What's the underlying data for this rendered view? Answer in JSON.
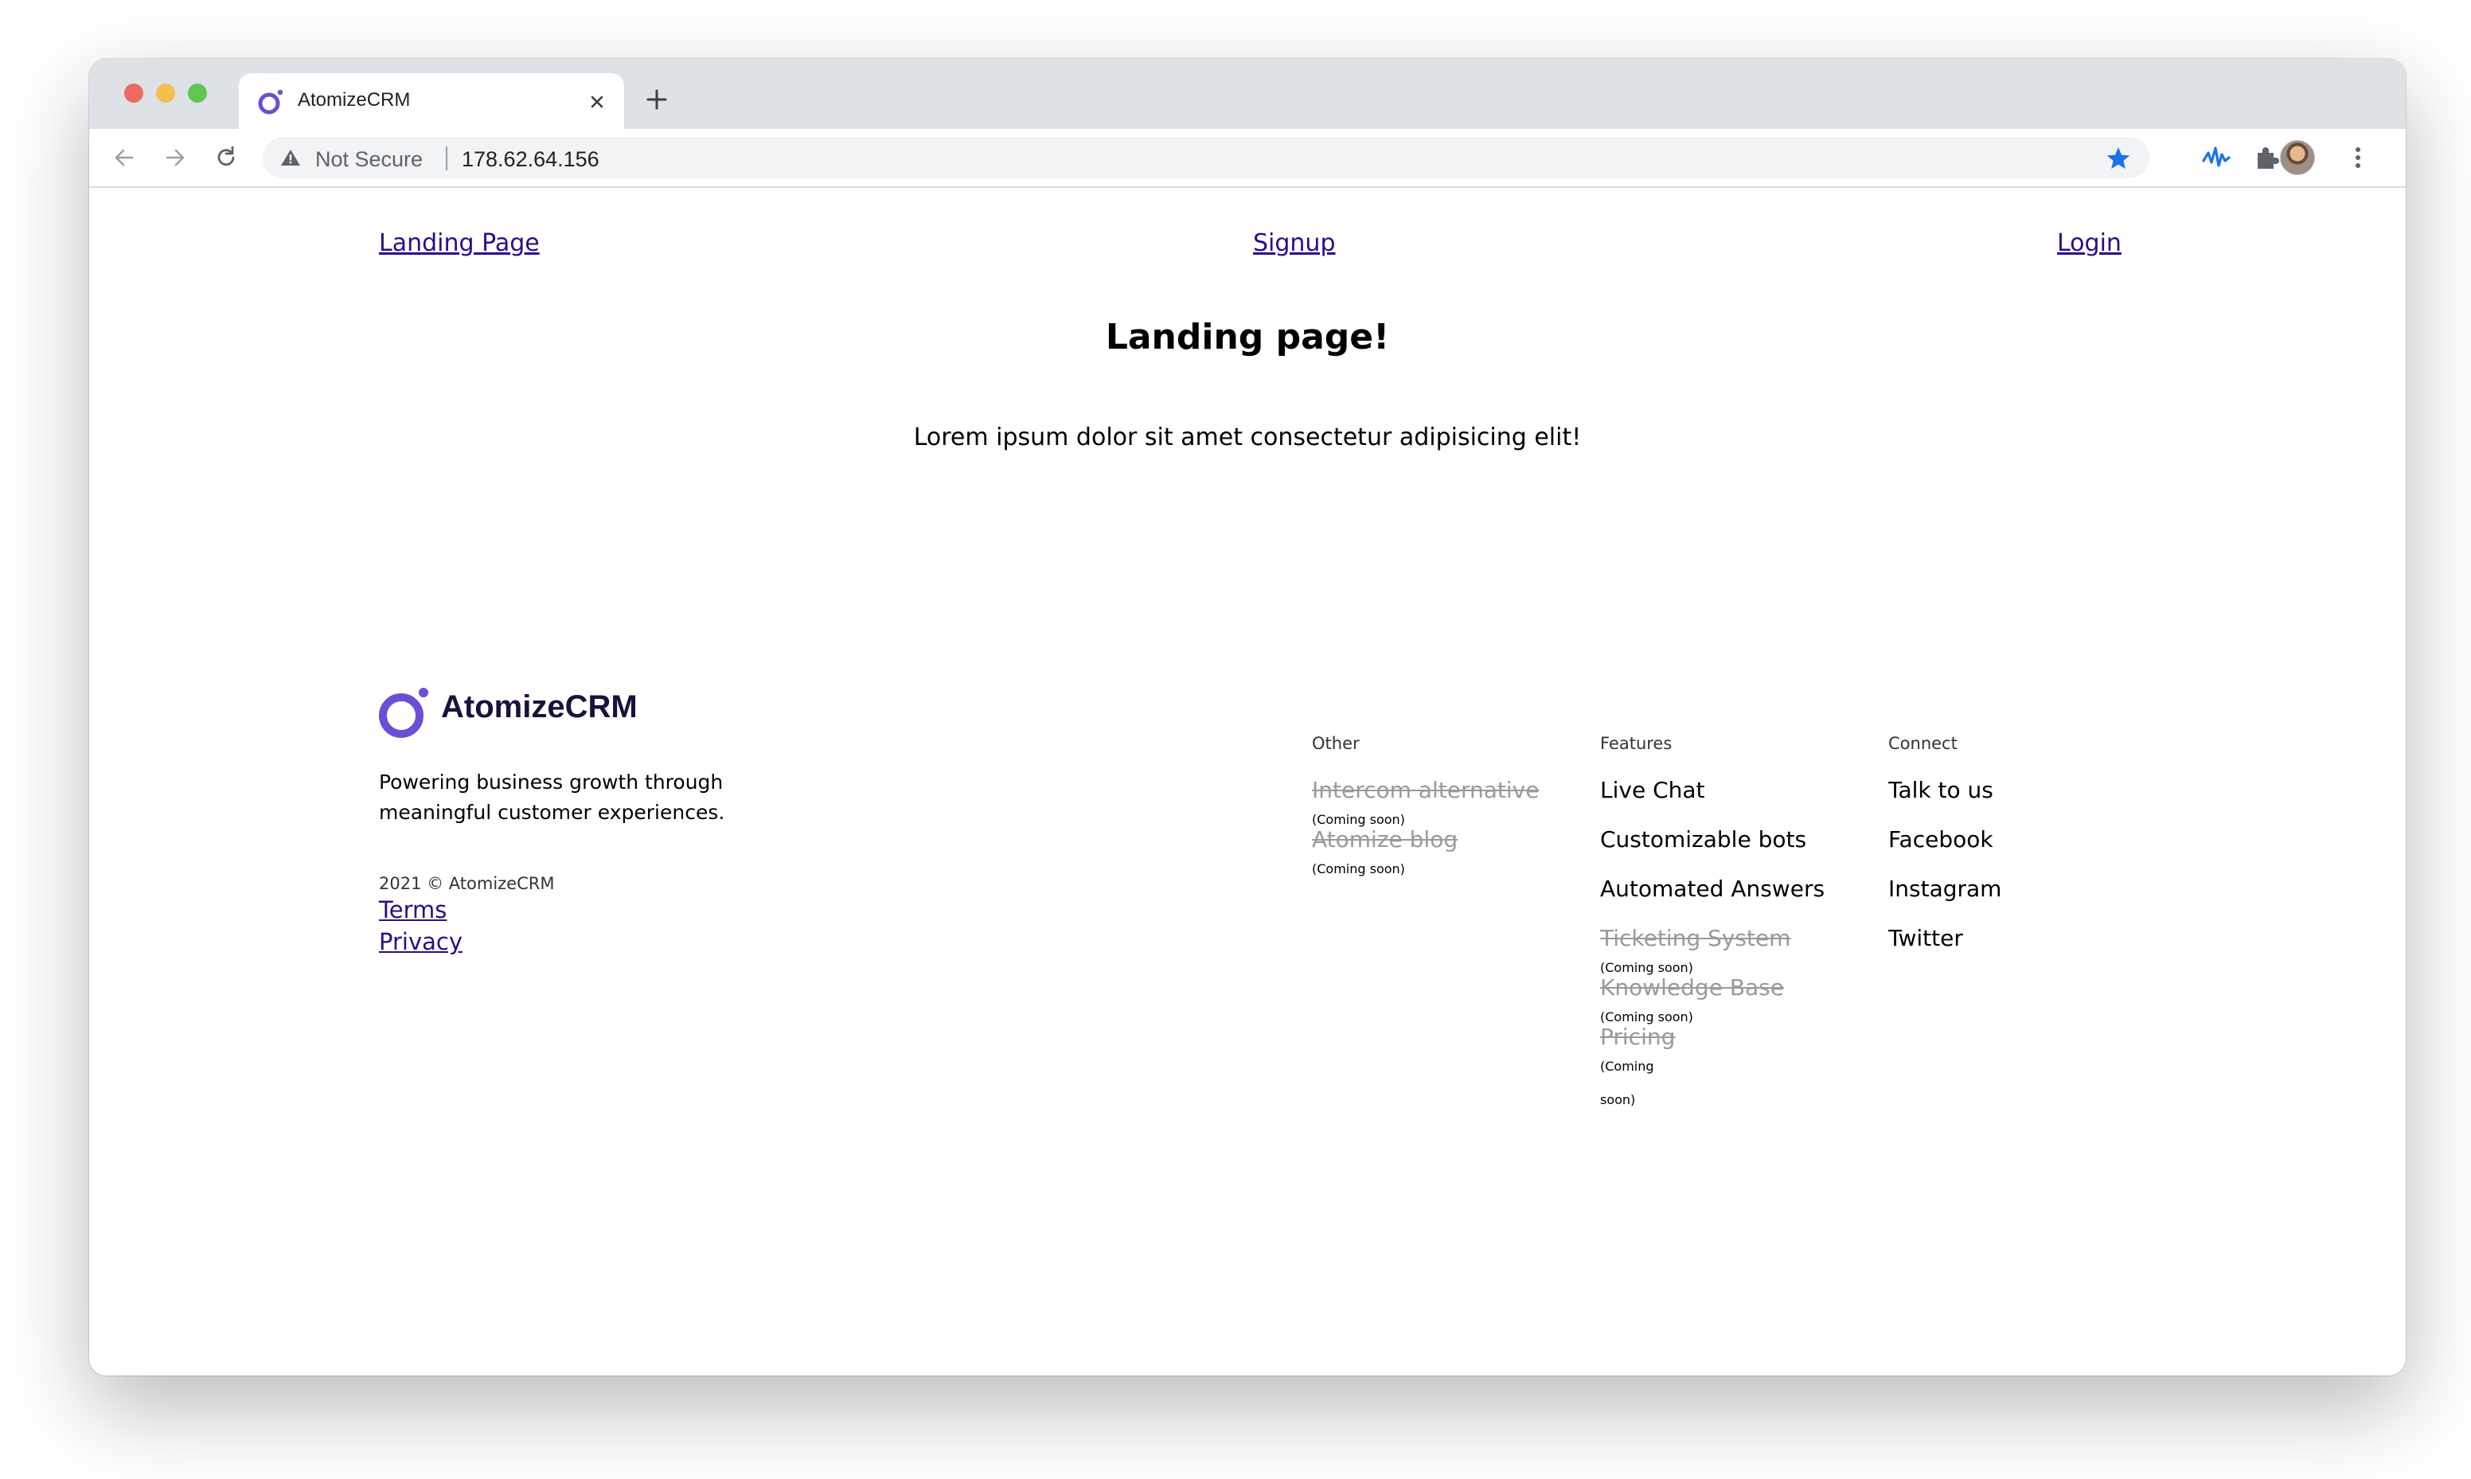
{
  "browser": {
    "tab_title": "AtomizeCRM",
    "security_label": "Not Secure",
    "url": "178.62.64.156"
  },
  "nav": {
    "landing": "Landing Page",
    "signup": "Signup",
    "login": "Login"
  },
  "main": {
    "heading": "Landing page!",
    "lead": "Lorem ipsum dolor sit amet consectetur adipisicing elit!"
  },
  "footer": {
    "brand": "AtomizeCRM",
    "tagline": "Powering business growth through meaningful customer experiences.",
    "copyright": "2021 © AtomizeCRM",
    "terms": "Terms",
    "privacy": "Privacy",
    "other": {
      "title": "Other",
      "items": [
        {
          "label": "Intercom alternative",
          "note": "(Coming soon)"
        },
        {
          "label": "Atomize blog",
          "note": "(Coming soon)"
        }
      ]
    },
    "features": {
      "title": "Features",
      "items": [
        "Live Chat",
        "Customizable bots",
        "Automated Answers"
      ],
      "coming": [
        {
          "label": "Ticketing System",
          "note": "(Coming soon)"
        },
        {
          "label": "Knowledge Base",
          "note": "(Coming soon)"
        },
        {
          "label": "Pricing",
          "note_1": "(Coming",
          "note_2": "soon)"
        }
      ]
    },
    "connect": {
      "title": "Connect",
      "items": [
        "Talk to us",
        "Facebook",
        "Instagram",
        "Twitter"
      ]
    }
  },
  "colors": {
    "brand_purple": "#6a4fd6",
    "link": "#2a0d8a",
    "star_blue": "#1a73e8"
  }
}
